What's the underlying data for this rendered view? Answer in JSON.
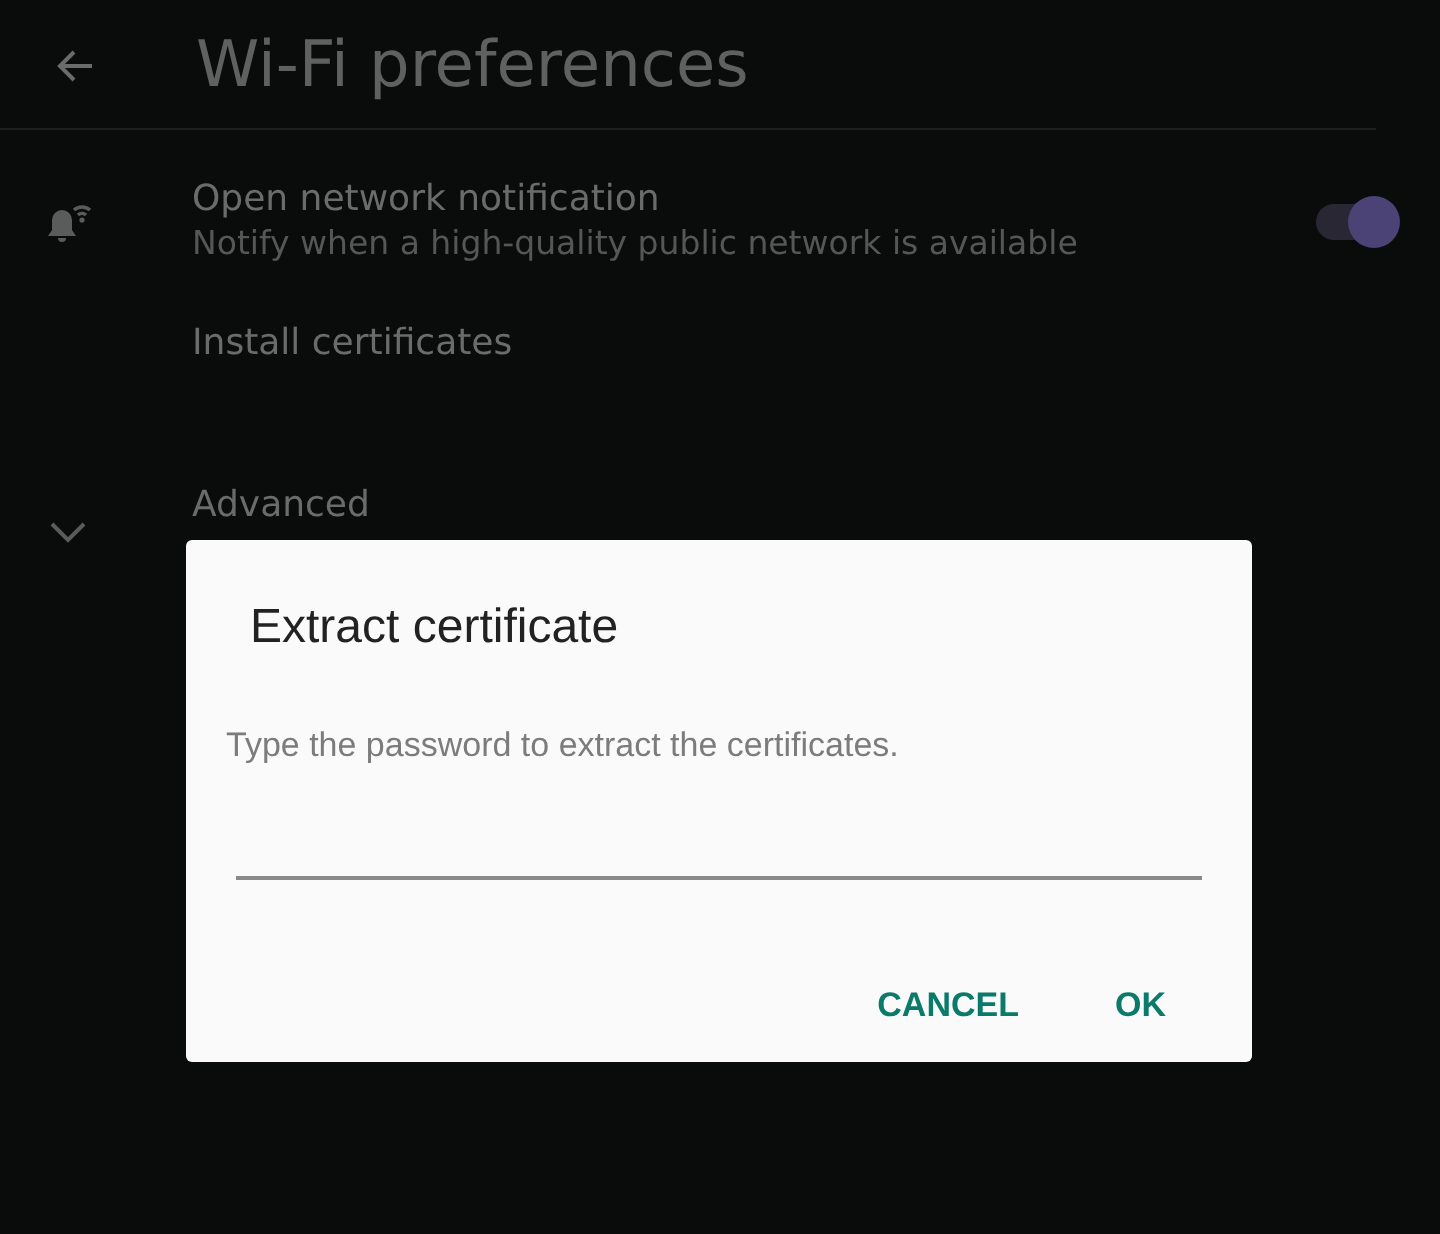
{
  "app_bar": {
    "title": "Wi-Fi preferences"
  },
  "settings": [
    {
      "kind": "toggle",
      "title": "Open network notification",
      "summary": "Notify when a high-quality public network is available",
      "on": true
    },
    {
      "kind": "plain",
      "title": "Install certificates"
    },
    {
      "kind": "expander",
      "title": "Advanced"
    }
  ],
  "dialog": {
    "title": "Extract certificate",
    "message": "Type the password to extract the certificates.",
    "buttons": [
      "CANCEL",
      "OK"
    ]
  }
}
